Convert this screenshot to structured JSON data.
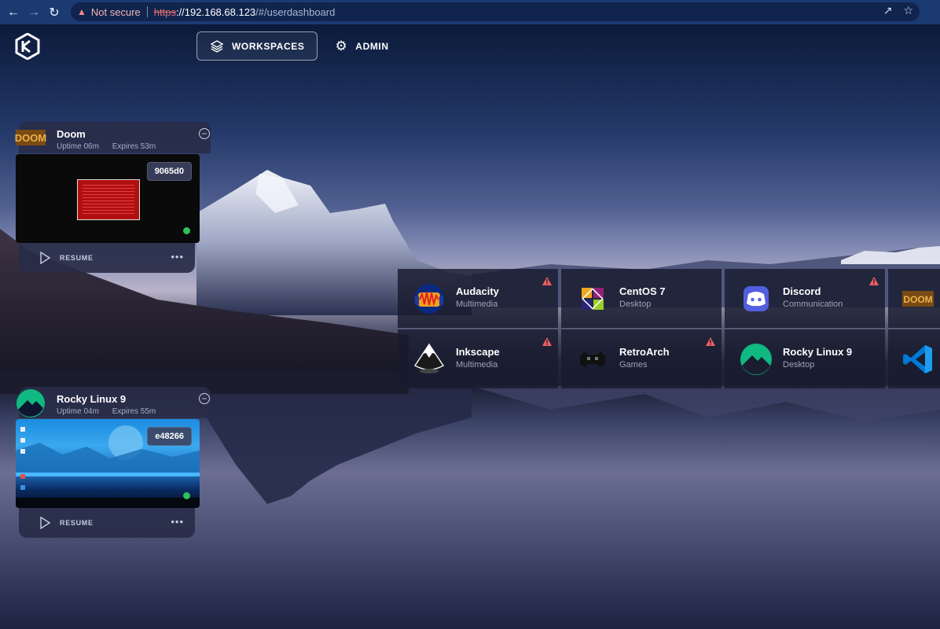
{
  "browser": {
    "not_secure": "Not secure",
    "url_scheme": "https",
    "url_host": "://192.168.68.123",
    "url_path": "/#/userdashboard"
  },
  "nav": {
    "workspaces": "WORKSPACES",
    "admin": "ADMIN"
  },
  "sessions": [
    {
      "title": "Doom",
      "uptime": "Uptime 06m",
      "expires": "Expires 53m",
      "id": "9065d0",
      "resume": "RESUME",
      "status_color": "#2fbf58"
    },
    {
      "title": "Rocky Linux 9",
      "uptime": "Uptime 04m",
      "expires": "Expires 55m",
      "id": "e48266",
      "resume": "RESUME",
      "status_color": "#2fbf58"
    }
  ],
  "apps": [
    {
      "name": "Audacity",
      "category": "Multimedia",
      "warning": true,
      "icon": "audacity-icon"
    },
    {
      "name": "CentOS 7",
      "category": "Desktop",
      "warning": false,
      "icon": "centos-icon"
    },
    {
      "name": "Discord",
      "category": "Communication",
      "warning": true,
      "icon": "discord-icon"
    },
    {
      "name": "",
      "category": "",
      "warning": false,
      "icon": "doom-icon"
    },
    {
      "name": "Inkscape",
      "category": "Multimedia",
      "warning": true,
      "icon": "inkscape-icon"
    },
    {
      "name": "RetroArch",
      "category": "Games",
      "warning": true,
      "icon": "retroarch-icon"
    },
    {
      "name": "Rocky Linux 9",
      "category": "Desktop",
      "warning": false,
      "icon": "rocky-linux-icon"
    },
    {
      "name": "",
      "category": "",
      "warning": false,
      "icon": "vscode-icon"
    }
  ],
  "colors": {
    "accent_green": "#2fbf58",
    "warning_red": "#f06060",
    "browser_bar": "#1c3a72"
  }
}
